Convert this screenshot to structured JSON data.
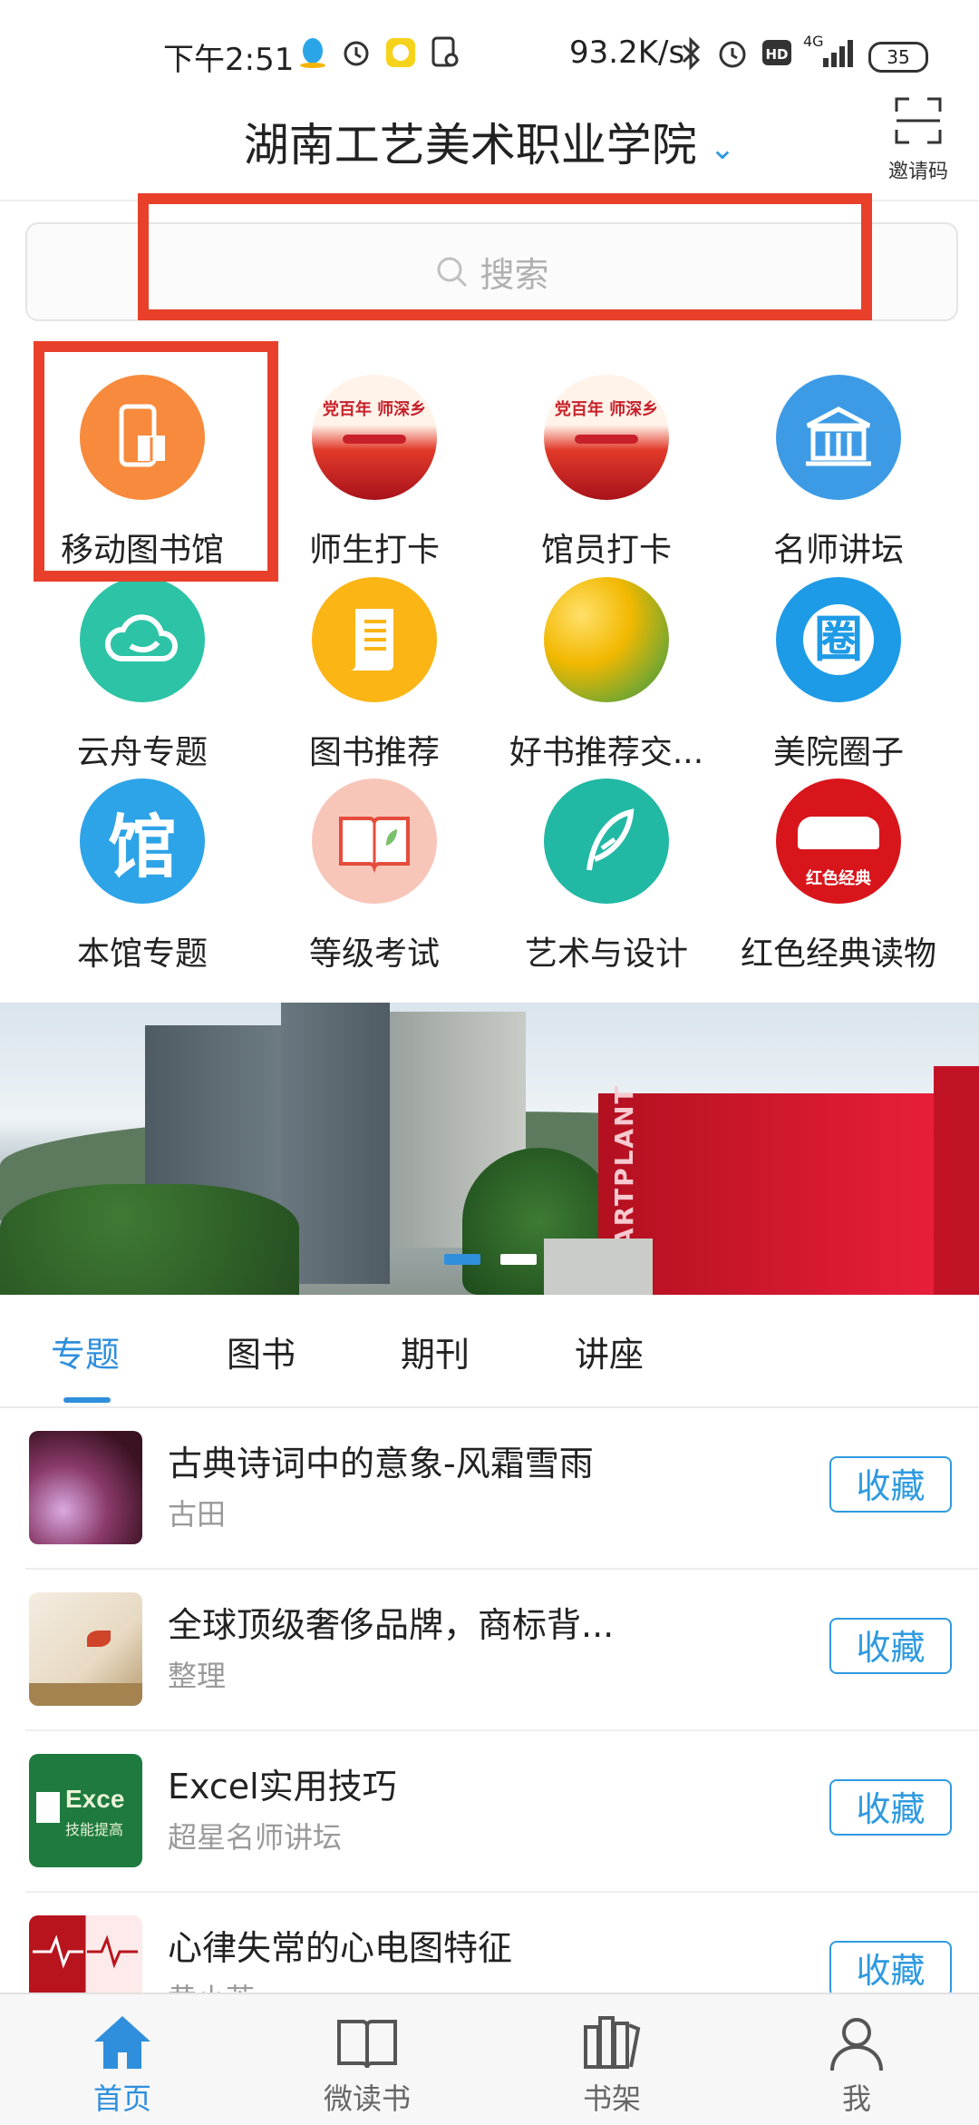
{
  "status_bar": {
    "time": "下午2:51",
    "network_speed": "93.2K/s",
    "signal": "4G",
    "battery": "35"
  },
  "header": {
    "title": "湖南工艺美术职业学院",
    "invite_label": "邀请码"
  },
  "search": {
    "placeholder": "搜索"
  },
  "grid": [
    {
      "label": "移动图书馆",
      "icon": "mobile-library-icon",
      "color": "#f78a3c"
    },
    {
      "label": "师生打卡",
      "icon": "checkin-poster-icon",
      "color": "#c8202a"
    },
    {
      "label": "馆员打卡",
      "icon": "checkin-poster-icon",
      "color": "#c8202a"
    },
    {
      "label": "名师讲坛",
      "icon": "building-icon",
      "color": "#3d9be6"
    },
    {
      "label": "云舟专题",
      "icon": "cloud-icon",
      "color": "#2cc3a6"
    },
    {
      "label": "图书推荐",
      "icon": "document-icon",
      "color": "#fbb514"
    },
    {
      "label": "好书推荐交...",
      "icon": "tulip-photo-icon",
      "color": "#e9b319"
    },
    {
      "label": "美院圈子",
      "icon": "circle-logo-icon",
      "color": "#1e9be6"
    },
    {
      "label": "本馆专题",
      "icon": "guan-char-icon",
      "color": "#2da3e8"
    },
    {
      "label": "等级考试",
      "icon": "open-book-icon",
      "color": "#f7c6b9"
    },
    {
      "label": "艺术与设计",
      "icon": "feather-icon",
      "color": "#21b8a4"
    },
    {
      "label": "红色经典读物",
      "icon": "red-classic-icon",
      "color": "#d9151c"
    }
  ],
  "grid_chars": {
    "guan": "馆",
    "quan": "圈",
    "poster_text": "党百年 师深乡",
    "red_classic_text": "红色经典"
  },
  "banner": {
    "sign_text": "ARTPLANT"
  },
  "tabs": [
    "专题",
    "图书",
    "期刊",
    "讲座"
  ],
  "list": [
    {
      "title": "古典诗词中的意象-风霜雪雨",
      "subtitle": "古田",
      "button": "收藏"
    },
    {
      "title": "全球顶级奢侈品牌，商标背...",
      "subtitle": "整理",
      "button": "收藏"
    },
    {
      "title": "Excel实用技巧",
      "subtitle": "超星名师讲坛",
      "button": "收藏",
      "thumb_text": "Exce",
      "thumb_sub": "技能提高"
    },
    {
      "title": "心律失常的心电图特征",
      "subtitle": "黄小芳",
      "button": "收藏"
    }
  ],
  "bottom_nav": [
    {
      "label": "首页",
      "icon": "home-icon",
      "active": true
    },
    {
      "label": "微读书",
      "icon": "book-icon",
      "active": false
    },
    {
      "label": "书架",
      "icon": "bookshelf-icon",
      "active": false
    },
    {
      "label": "我",
      "icon": "profile-icon",
      "active": false
    }
  ],
  "colors": {
    "accent": "#2f8fdc",
    "highlight": "#e8402a"
  }
}
